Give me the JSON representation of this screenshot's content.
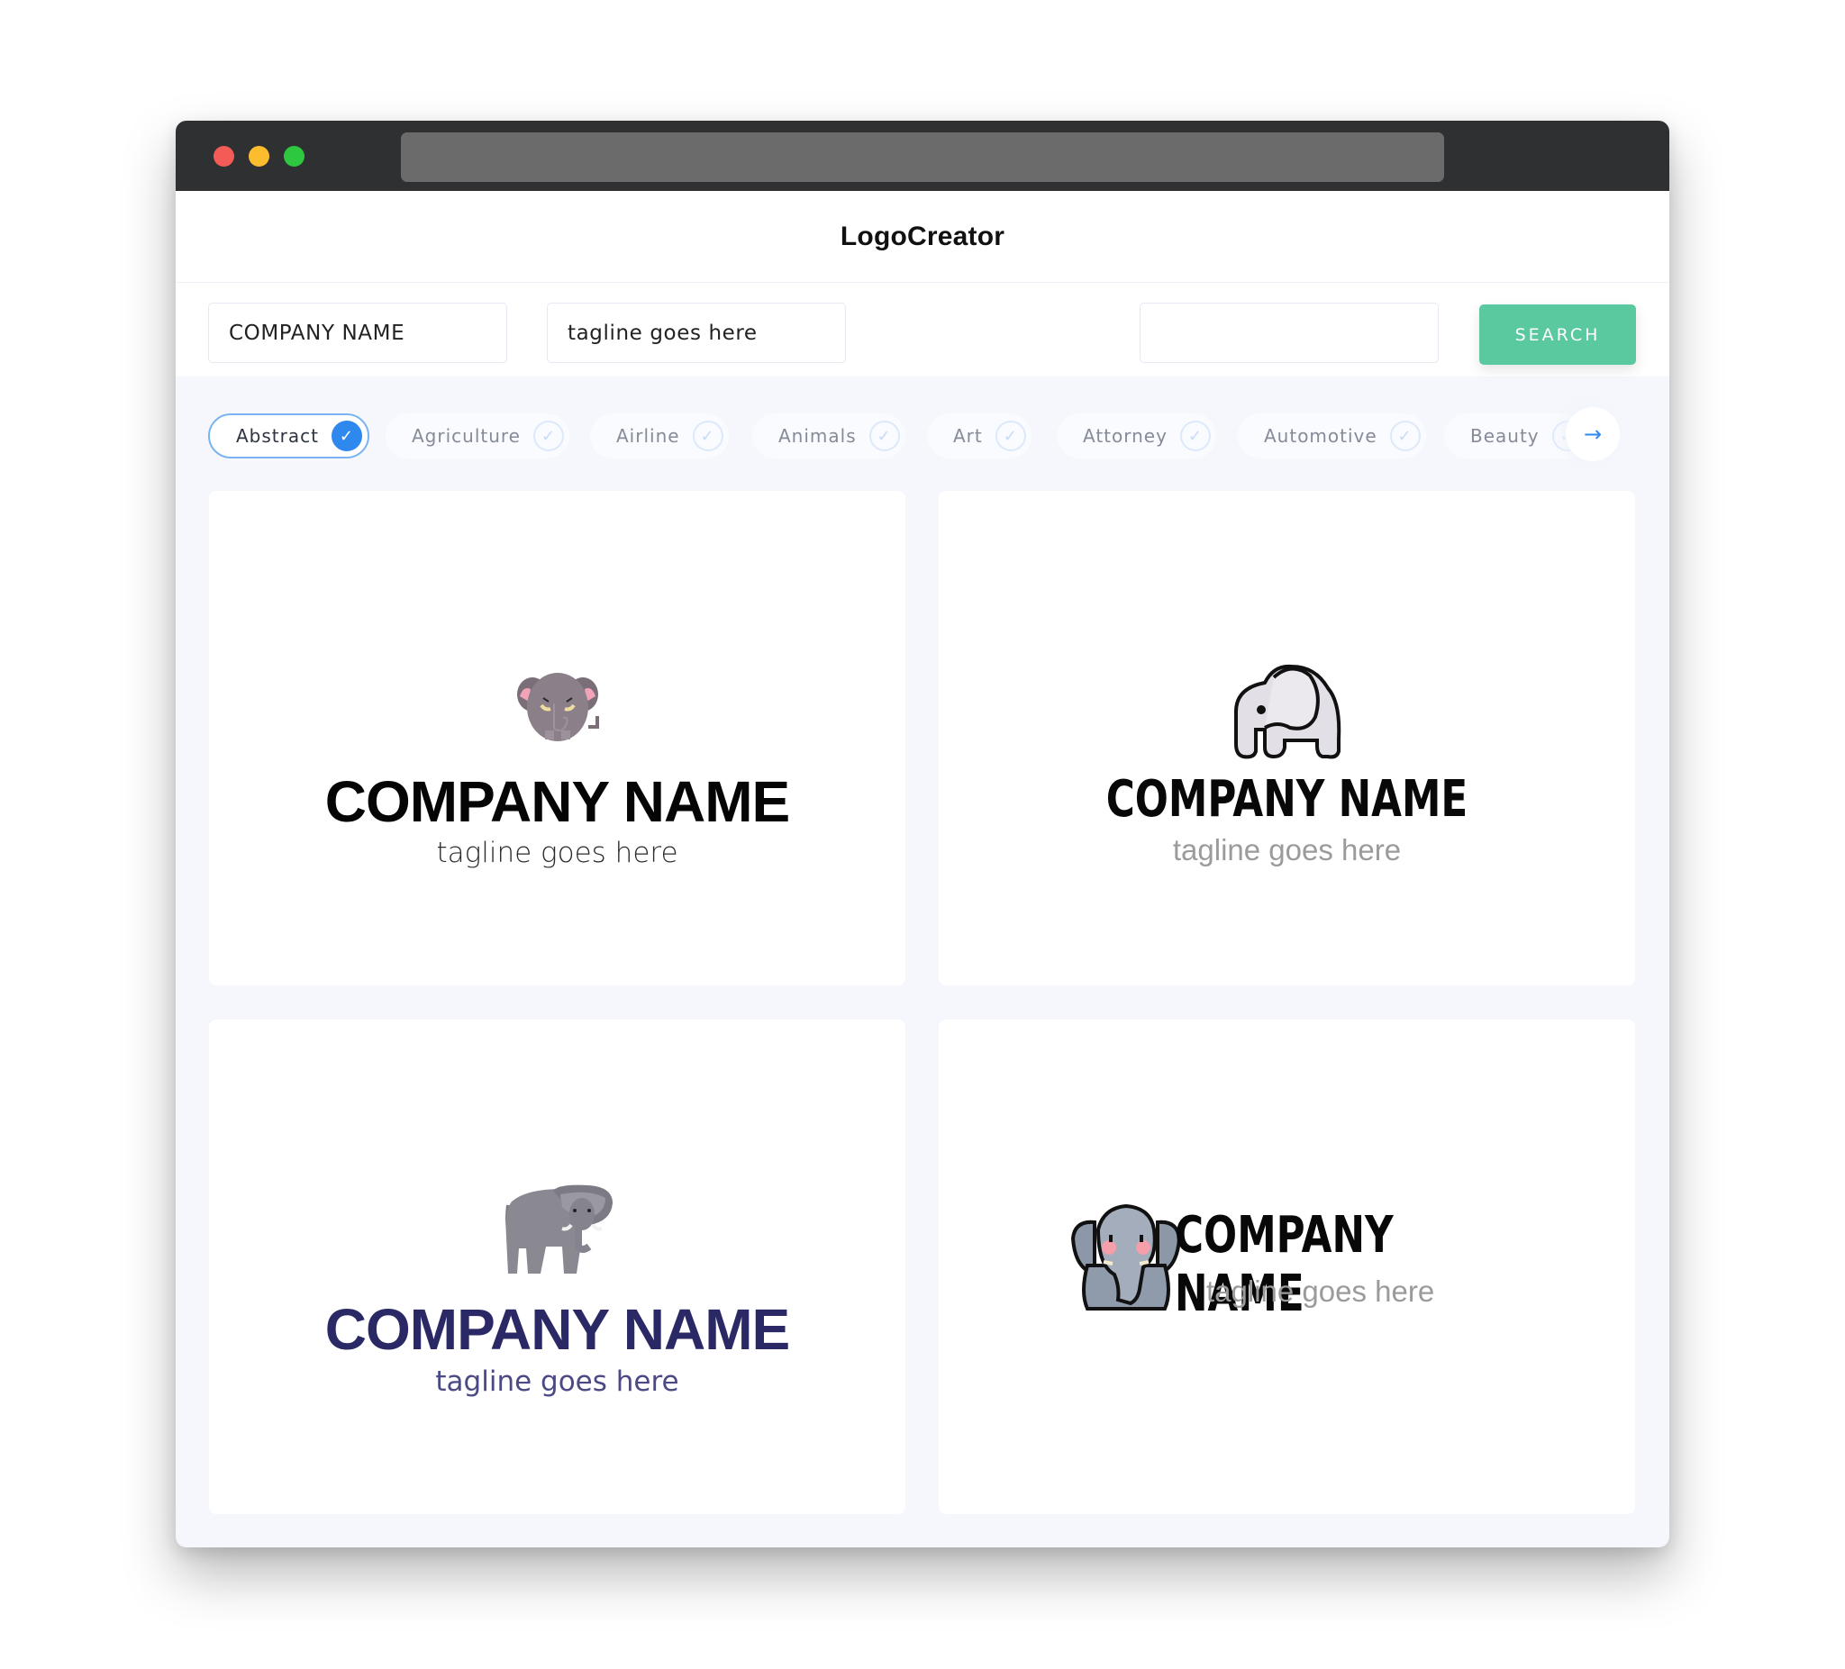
{
  "app": {
    "brand": "LogoCreator"
  },
  "inputs": {
    "company_name_value": "COMPANY NAME",
    "tagline_value": "tagline goes here",
    "extra_value": "",
    "search_label": "SEARCH"
  },
  "categories": [
    {
      "label": "Abstract",
      "selected": true
    },
    {
      "label": "Agriculture",
      "selected": false
    },
    {
      "label": "Airline",
      "selected": false
    },
    {
      "label": "Animals",
      "selected": false
    },
    {
      "label": "Art",
      "selected": false
    },
    {
      "label": "Attorney",
      "selected": false
    },
    {
      "label": "Automotive",
      "selected": false
    },
    {
      "label": "Beauty",
      "selected": false
    }
  ],
  "icons": {
    "check": "✓",
    "next_arrow": "→"
  },
  "logos": [
    {
      "company": "COMPANY NAME",
      "tagline": "tagline goes here",
      "icon": "round-elephant-icon",
      "layout": "stacked",
      "name_color": "#050505"
    },
    {
      "company": "COMPANY NAME",
      "tagline": "tagline goes here",
      "icon": "outline-baby-elephant-icon",
      "layout": "stacked",
      "name_color": "#080808"
    },
    {
      "company": "COMPANY NAME",
      "tagline": "tagline goes here",
      "icon": "standing-elephant-icon",
      "layout": "stacked",
      "name_color": "#2a2965"
    },
    {
      "company": "COMPANY NAME",
      "tagline": "tagline goes here",
      "icon": "sitting-elephant-icon",
      "layout": "inline",
      "name_color": "#080808"
    }
  ],
  "colors": {
    "accent_blue": "#2f88ee",
    "search_green": "#5ac9a0",
    "titlebar": "#2f3032",
    "window_bg": "#f5f7fd"
  }
}
